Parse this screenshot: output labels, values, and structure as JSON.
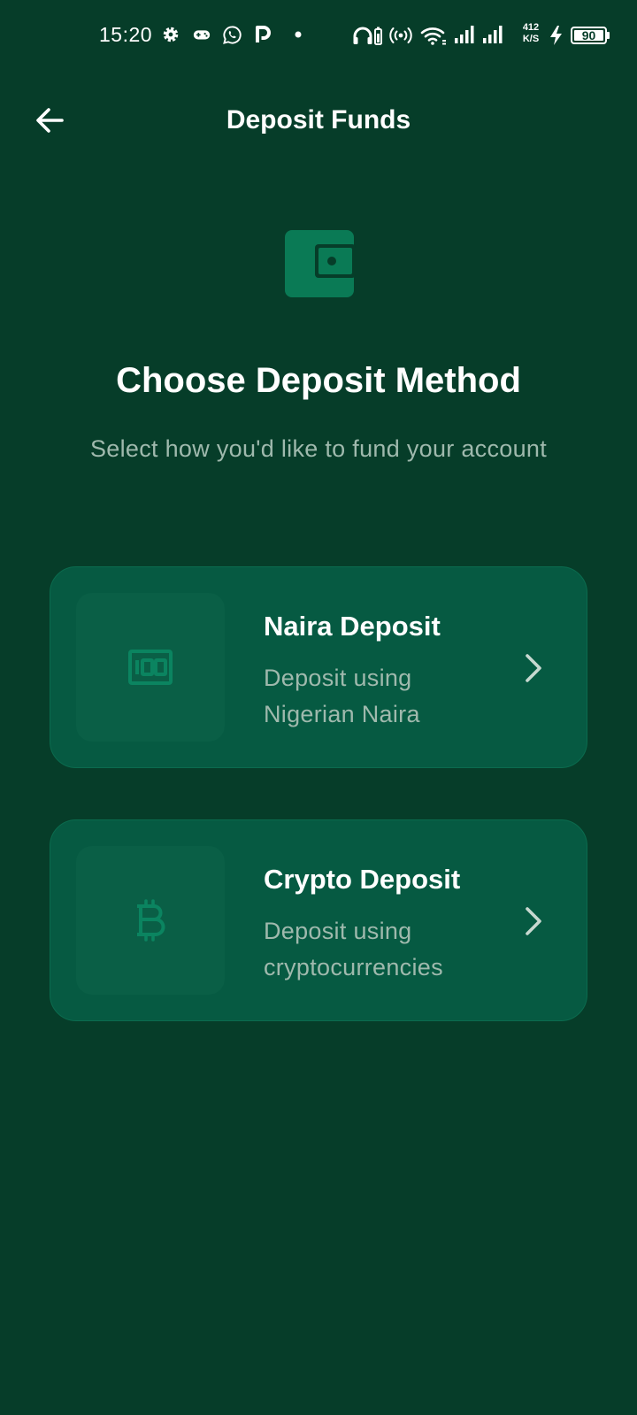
{
  "status_bar": {
    "time": "15:20",
    "net_speed_value": "412",
    "net_speed_unit": "K/S",
    "battery": "90"
  },
  "app_bar": {
    "title": "Deposit Funds"
  },
  "page": {
    "heading": "Choose Deposit Method",
    "subheading": "Select how you'd like to fund your account"
  },
  "methods": [
    {
      "title": "Naira Deposit",
      "desc_line1": "Deposit using",
      "desc_line2": "Nigerian Naira",
      "icon": "banknote-icon"
    },
    {
      "title": "Crypto Deposit",
      "desc_line1": "Deposit using",
      "desc_line2": "cryptocurrencies",
      "icon": "bitcoin-icon"
    }
  ],
  "colors": {
    "background": "#063d29",
    "card": "#065a42",
    "accent": "#0a7a55",
    "muted_text": "#9fb9ad"
  }
}
